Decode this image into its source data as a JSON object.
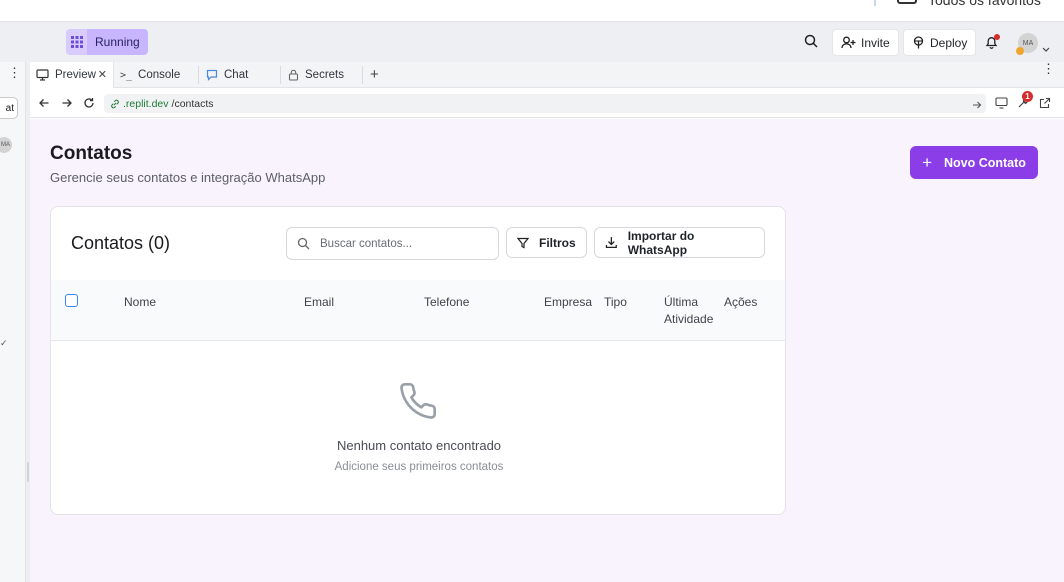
{
  "browser": {
    "favorites_text": "Todos os favoritos"
  },
  "header": {
    "status_label": "Running",
    "invite_label": "Invite",
    "deploy_label": "Deploy",
    "avatar_initials": "MA"
  },
  "sidebar_partial": {
    "chip_text": "at",
    "avatar_initials": "MA"
  },
  "tabs": [
    {
      "label": "Preview",
      "icon": "monitor-icon",
      "active": true
    },
    {
      "label": "Console",
      "icon": "terminal-icon",
      "active": false
    },
    {
      "label": "Chat",
      "icon": "chat-bubble-icon",
      "active": false
    },
    {
      "label": "Secrets",
      "icon": "lock-icon",
      "active": false
    }
  ],
  "urlbar": {
    "host": ".replit.dev",
    "path": "/contacts",
    "devtools_badge": "1"
  },
  "page": {
    "title": "Contatos",
    "subtitle": "Gerencie seus contatos e integração WhatsApp",
    "new_contact_label": "Novo Contato"
  },
  "card": {
    "title": "Contatos (0)",
    "search_placeholder": "Buscar contatos...",
    "filters_label": "Filtros",
    "import_label": "Importar do WhatsApp",
    "columns": {
      "name": "Nome",
      "email": "Email",
      "phone": "Telefone",
      "company": "Empresa",
      "type": "Tipo",
      "last_activity_1": "Última",
      "last_activity_2": "Atividade",
      "actions": "Ações"
    },
    "empty_title": "Nenhum contato encontrado",
    "empty_subtitle": "Adicione seus primeiros contatos"
  },
  "colors": {
    "primary": "#8b3de8",
    "running_pill": "#c7b6ff",
    "preview_bg": "#f8f3fd",
    "url_host": "#1f7a35",
    "checkbox": "#3b82f6"
  }
}
